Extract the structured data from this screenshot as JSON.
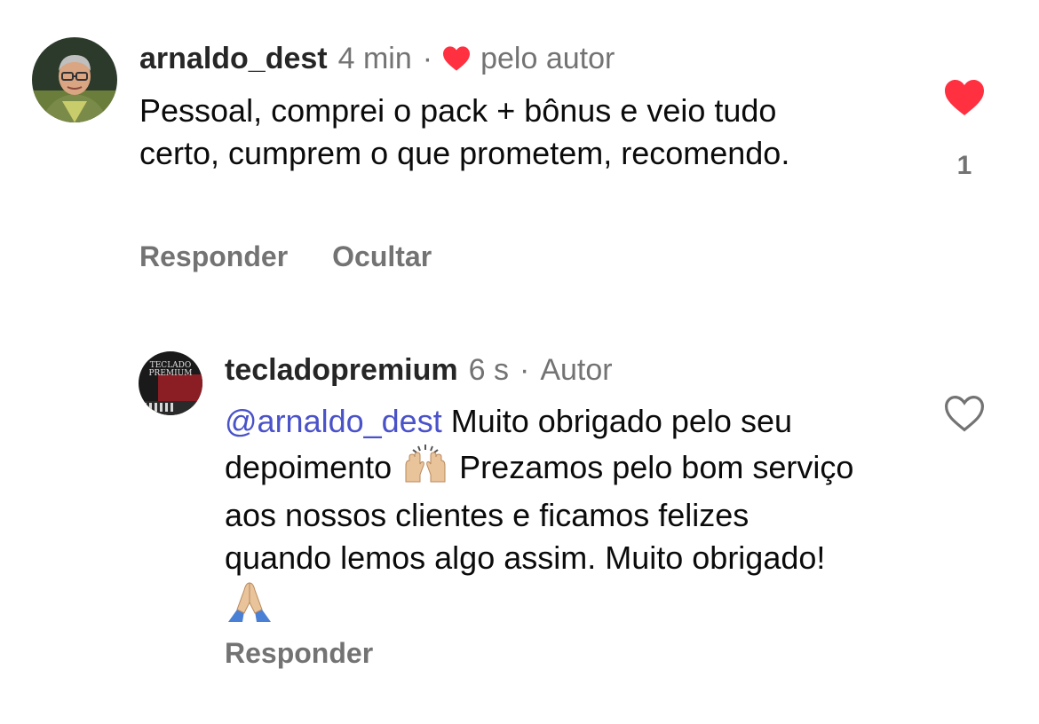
{
  "comments": [
    {
      "username": "arnaldo_dest",
      "time": "4 min",
      "separator": "·",
      "liked_by_author_label": "pelo autor",
      "text": "Pessoal, comprei o pack + bônus e veio tudo certo, cumprem o que prometem, recomendo.",
      "like_count": "1",
      "liked": true,
      "actions": {
        "reply": "Responder",
        "hide": "Ocultar"
      }
    },
    {
      "username": "tecladopremium",
      "time": "6 s",
      "separator": "·",
      "author_badge": "Autor",
      "mention": "@arnaldo_dest",
      "text_part1": "Muito obrigado pelo seu depoimento",
      "text_part2": "Prezamos pelo bom serviço aos nossos clientes e ficamos felizes quando lemos algo assim. Muito obrigado!",
      "avatar_text": "TECLADO PREMIUM",
      "liked": false,
      "actions": {
        "reply": "Responder"
      }
    }
  ],
  "colors": {
    "like_red": "#ff3040",
    "mention_blue": "#4a52c9",
    "secondary_gray": "#737373"
  },
  "icons": {
    "liked_by_author": "heart-filled-icon",
    "like_active": "heart-filled-icon",
    "like_inactive": "heart-outline-icon",
    "emoji_1": "raising-hands-emoji",
    "emoji_2": "folded-hands-emoji"
  }
}
